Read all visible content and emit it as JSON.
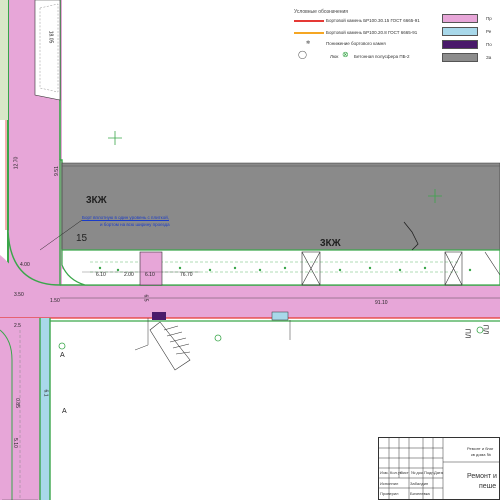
{
  "legend": {
    "title": "Условные обозначения",
    "items": [
      {
        "label": "Бортовой камень БР100.30.15 ГОСТ 6665-91",
        "color": "#e53935"
      },
      {
        "label": "Бортовой камень БР100.20.8 ГОСТ 6665-91",
        "color": "#f5a623"
      },
      {
        "label": "Понижение бортового камня"
      },
      {
        "label": "Люк"
      },
      {
        "label": "Бетонная полусфера ПБ-2"
      }
    ],
    "right_labels": [
      "Пр",
      "Ре",
      "По",
      "За"
    ],
    "swatches": [
      "#e7a6d8",
      "#a8d8ea",
      "#4a1a6b",
      "#8c8c8c"
    ]
  },
  "map_labels": {
    "building_code_1": "3КЖ",
    "building_code_2": "3КЖ",
    "number_15": "15",
    "note_line1": "Борт вплотную в один уровень с плиткой,",
    "note_line2": "и бортом на всю ширину проезда",
    "dim_1": "91.10",
    "dim_2": "76.70",
    "dim_3": "6.10",
    "dim_4": "6.10",
    "dim_5": "1.50",
    "dim_6": "3.50",
    "dim_7": "18.05",
    "dim_8": "12.70",
    "dim_9": "2.00",
    "dim_10": "4.00",
    "dim_11": "6.5",
    "dim_12": "9.51",
    "dim_13": "5.10",
    "dim_14": "2.5",
    "dim_15": "0.85",
    "dim_16": "6.1",
    "side_a": "ПЛ",
    "side_b": "ПЛ",
    "mark_a": "А",
    "mark_b": "А"
  },
  "stamp": {
    "title_line1": "Ремонт и",
    "title_line2": "пеше",
    "right_small1": "Ремонт и благ",
    "right_small2": "кв дома №",
    "cols": [
      "Изм.",
      "Кол.уч",
      "Лист",
      "№ док.",
      "Подп.",
      "Дата"
    ],
    "row1": "Исполнил",
    "row2": "Проверил",
    "name1": "Забалдин",
    "name2": "Бичелевка"
  },
  "colors": {
    "pink": "#e7a6d8",
    "green_line": "#3aa64a",
    "red_line": "#e53935",
    "gray_building": "#8a8a8a",
    "blue_water": "#a8d8ea"
  }
}
